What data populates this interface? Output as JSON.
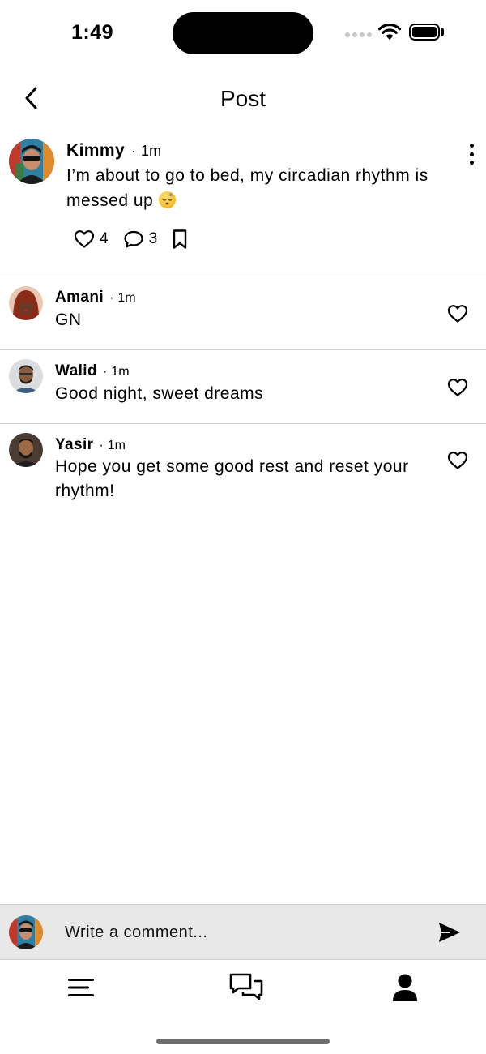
{
  "status_bar": {
    "time": "1:49"
  },
  "nav": {
    "title": "Post"
  },
  "post": {
    "author": "Kimmy",
    "dot": "·",
    "time": "1m",
    "text": "I’m about to go to bed, my circadian rhythm is messed up",
    "emoji": "sleeping-face",
    "likes": "4",
    "comments": "3"
  },
  "comments": [
    {
      "author": "Amani",
      "dot": "·",
      "time": "1m",
      "text": "GN"
    },
    {
      "author": "Walid",
      "dot": "·",
      "time": "1m",
      "text": "Good night, sweet dreams"
    },
    {
      "author": "Yasir",
      "dot": "·",
      "time": "1m",
      "text": "Hope you get some good rest and reset your rhythm!"
    }
  ],
  "composer": {
    "placeholder": "Write a comment..."
  },
  "tabbar": {
    "items": [
      "menu-icon",
      "chat-bubbles-icon",
      "profile-icon"
    ]
  }
}
